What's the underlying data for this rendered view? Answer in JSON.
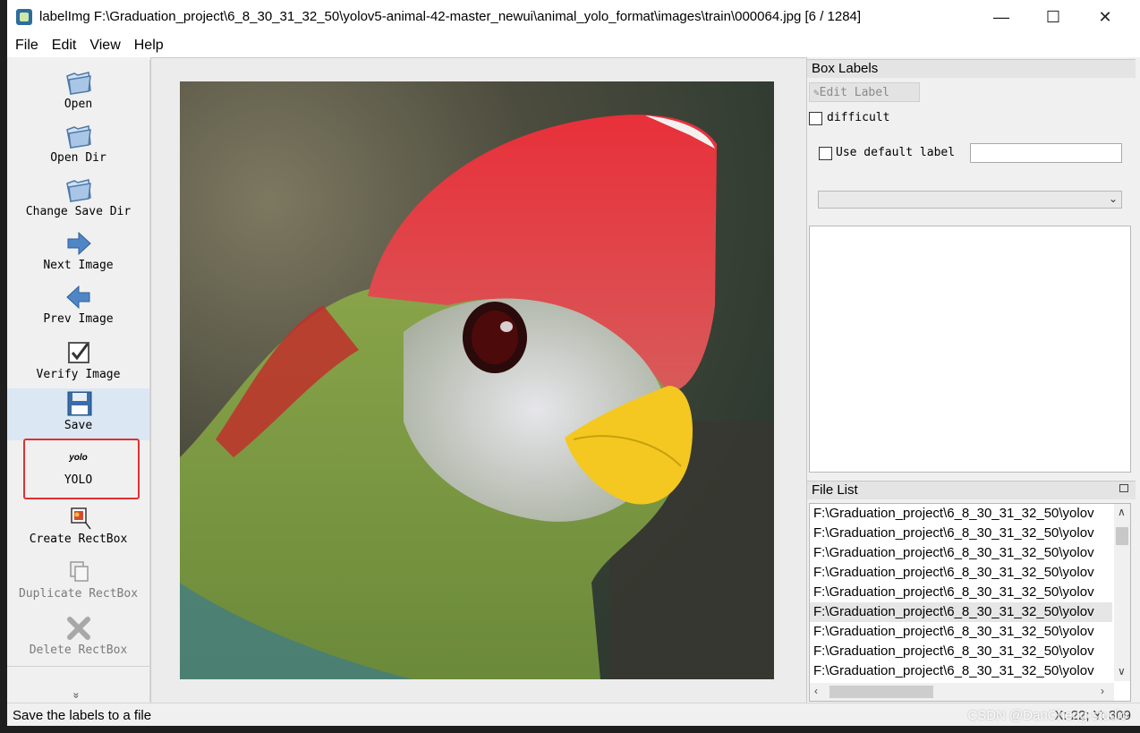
{
  "window": {
    "title": "labelImg F:\\Graduation_project\\6_8_30_31_32_50\\yolov5-animal-42-master_newui\\animal_yolo_format\\images\\train\\000064.jpg [6 / 1284]",
    "minimize": "—",
    "maximize": "☐",
    "close": "✕"
  },
  "menu": [
    "File",
    "Edit",
    "View",
    "Help"
  ],
  "toolbar": {
    "open": "Open",
    "open_dir": "Open Dir",
    "change_save_dir": "Change Save Dir",
    "next_image": "Next Image",
    "prev_image": "Prev Image",
    "verify_image": "Verify Image",
    "save": "Save",
    "yolo_icon": "yolo",
    "yolo": "YOLO",
    "create_rectbox": "Create RectBox",
    "duplicate_rectbox": "Duplicate RectBox",
    "delete_rectbox": "Delete RectBox",
    "more": "»"
  },
  "box_labels": {
    "header": "Box Labels",
    "edit_label": "Edit Label",
    "difficult": "difficult",
    "use_default_label": "Use default label",
    "default_label_value": ""
  },
  "file_list": {
    "header": "File List",
    "items": [
      "F:\\Graduation_project\\6_8_30_31_32_50\\yolov",
      "F:\\Graduation_project\\6_8_30_31_32_50\\yolov",
      "F:\\Graduation_project\\6_8_30_31_32_50\\yolov",
      "F:\\Graduation_project\\6_8_30_31_32_50\\yolov",
      "F:\\Graduation_project\\6_8_30_31_32_50\\yolov",
      "F:\\Graduation_project\\6_8_30_31_32_50\\yolov",
      "F:\\Graduation_project\\6_8_30_31_32_50\\yolov",
      "F:\\Graduation_project\\6_8_30_31_32_50\\yolov",
      "F:\\Graduation_project\\6_8_30_31_32_50\\yolov"
    ],
    "selected_index": 5
  },
  "status": {
    "message": "Save the labels to a file",
    "coords": "X: 22; Y: 309",
    "watermark": "CSDN @DanCheng-studio"
  },
  "colors": {
    "highlight_box": "#e03030",
    "active_tool_bg": "#dbe7f3"
  }
}
